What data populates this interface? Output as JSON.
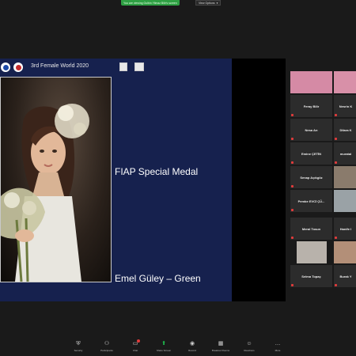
{
  "banner": {
    "sharing_text": "You are viewing Gulbin Yilmaz Bilir's screen",
    "view_options": "View Options"
  },
  "slide": {
    "title": "3rd Female World 2020",
    "award": "FIAP Special Medal",
    "author": "Emel Güley – Green"
  },
  "participants": [
    {
      "name": "",
      "video": true
    },
    {
      "name": "",
      "video": true
    },
    {
      "name": "Feray Bilir",
      "video": false
    },
    {
      "name": "Nesrin K",
      "video": false
    },
    {
      "name": "Nesa Arı",
      "video": false
    },
    {
      "name": "Dilara K",
      "video": false
    },
    {
      "name": "Emine ÇETİN",
      "video": false
    },
    {
      "name": "muratal",
      "video": false
    },
    {
      "name": "Senap Açıkgöz",
      "video": false
    },
    {
      "name": "",
      "video": true
    },
    {
      "name": "Pembe EVCİ ÇÜ...",
      "video": false
    },
    {
      "name": "",
      "video": true
    },
    {
      "name": "Meral Tosun",
      "video": false
    },
    {
      "name": "Hanife I",
      "video": false
    },
    {
      "name": "",
      "video": true
    },
    {
      "name": "",
      "video": true
    },
    {
      "name": "Selma Topaç",
      "video": false
    },
    {
      "name": "Burak Y",
      "video": false
    }
  ],
  "toolbar": {
    "items": [
      {
        "label": "Security",
        "icon": "shield-icon"
      },
      {
        "label": "Participants",
        "icon": "participants-icon"
      },
      {
        "label": "Chat",
        "icon": "chat-icon"
      },
      {
        "label": "Share Screen",
        "icon": "share-screen-icon"
      },
      {
        "label": "Record",
        "icon": "record-icon"
      },
      {
        "label": "Breakout Rooms",
        "icon": "breakout-rooms-icon"
      },
      {
        "label": "Reactions",
        "icon": "reactions-icon"
      },
      {
        "label": "More",
        "icon": "more-icon"
      }
    ]
  },
  "colors": {
    "slide_background": "#16214e",
    "share_green": "#2ea043",
    "mute_red": "#e23b3b"
  }
}
